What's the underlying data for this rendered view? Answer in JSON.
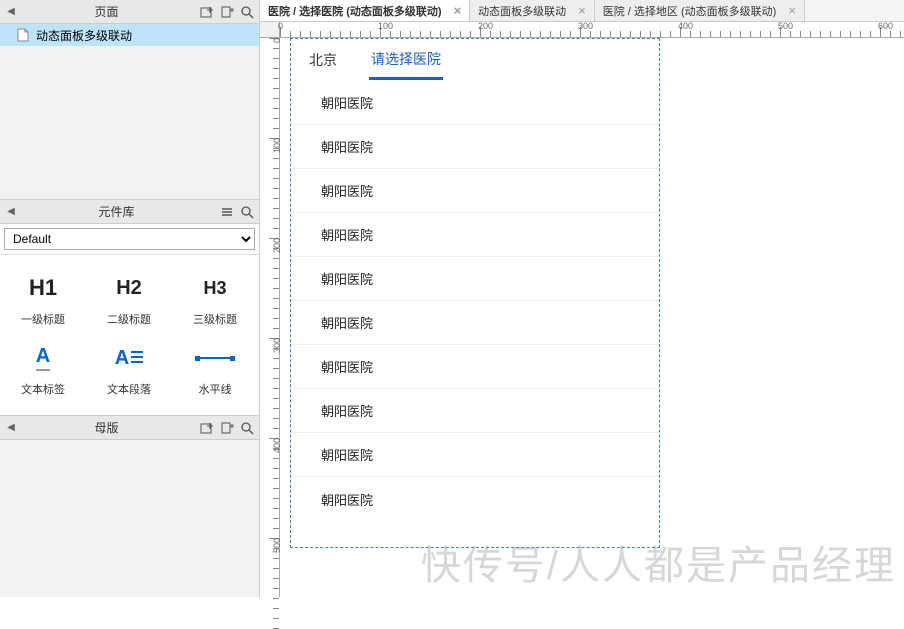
{
  "sidebar": {
    "pages": {
      "title": "页面",
      "items": [
        {
          "label": "动态面板多级联动",
          "selected": true
        }
      ]
    },
    "library": {
      "title": "元件库",
      "select_value": "Default",
      "widgets": [
        {
          "vis": "H1",
          "label": "一级标题"
        },
        {
          "vis": "H2",
          "label": "二级标题"
        },
        {
          "vis": "H3",
          "label": "三级标题"
        },
        {
          "vis": "A_",
          "label": "文本标签"
        },
        {
          "vis": "A≡",
          "label": "文本段落"
        },
        {
          "vis": "—",
          "label": "水平线"
        }
      ]
    },
    "masters": {
      "title": "母版"
    }
  },
  "tabs": [
    {
      "label": "医院 / 选择医院 (动态面板多级联动)",
      "active": true
    },
    {
      "label": "动态面板多级联动",
      "active": false
    },
    {
      "label": "医院 / 选择地区 (动态面板多级联动)",
      "active": false
    }
  ],
  "ruler_h": [
    "0",
    "100",
    "200",
    "300",
    "400",
    "500",
    "600"
  ],
  "ruler_v": [
    "0",
    "100",
    "200",
    "300",
    "400",
    "500"
  ],
  "canvas": {
    "dyn_tabs": [
      {
        "label": "北京",
        "active": false
      },
      {
        "label": "请选择医院",
        "active": true
      }
    ],
    "list": [
      "朝阳医院",
      "朝阳医院",
      "朝阳医院",
      "朝阳医院",
      "朝阳医院",
      "朝阳医院",
      "朝阳医院",
      "朝阳医院",
      "朝阳医院",
      "朝阳医院"
    ]
  },
  "watermark": "快传号/人人都是产品经理"
}
